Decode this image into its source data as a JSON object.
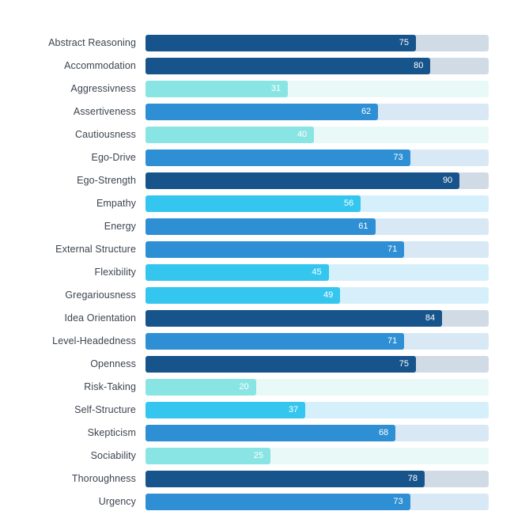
{
  "chart_data": {
    "type": "bar",
    "orientation": "horizontal",
    "title": "",
    "subtitle": "",
    "xlabel": "",
    "ylabel": "",
    "xlim": [
      0,
      100
    ],
    "grid": false,
    "legend": "none",
    "axis_ticks_visible": false,
    "value_labels_inside_bars": true,
    "categories": [
      "Abstract Reasoning",
      "Accommodation",
      "Aggressivness",
      "Assertiveness",
      "Cautiousness",
      "Ego-Drive",
      "Ego-Strength",
      "Empathy",
      "Energy",
      "External Structure",
      "Flexibility",
      "Gregariousness",
      "Idea Orientation",
      "Level-Headedness",
      "Openness",
      "Risk-Taking",
      "Self-Structure",
      "Skepticism",
      "Sociability",
      "Thoroughness",
      "Urgency"
    ],
    "values": [
      75,
      80,
      31,
      62,
      40,
      73,
      90,
      56,
      61,
      71,
      45,
      49,
      84,
      71,
      75,
      20,
      37,
      68,
      25,
      78,
      73
    ],
    "bands": [
      "navy",
      "navy",
      "turquoise",
      "blue",
      "turquoise",
      "blue",
      "navy",
      "cyan",
      "blue",
      "blue",
      "cyan",
      "cyan",
      "navy",
      "blue",
      "navy",
      "turquoise",
      "cyan",
      "blue",
      "turquoise",
      "navy",
      "blue"
    ],
    "palette": {
      "navy": "#17548b",
      "blue": "#2e8fd4",
      "cyan": "#35c6ef",
      "turquoise": "#89e5e3"
    },
    "track_palette": {
      "navy": "#d1dbe5",
      "blue": "#d8e9f5",
      "cyan": "#d6f0fb",
      "turquoise": "#e9f9f8"
    },
    "label_text_color": "#3c4450",
    "value_text_color": "#ffffff",
    "background": "#ffffff"
  }
}
